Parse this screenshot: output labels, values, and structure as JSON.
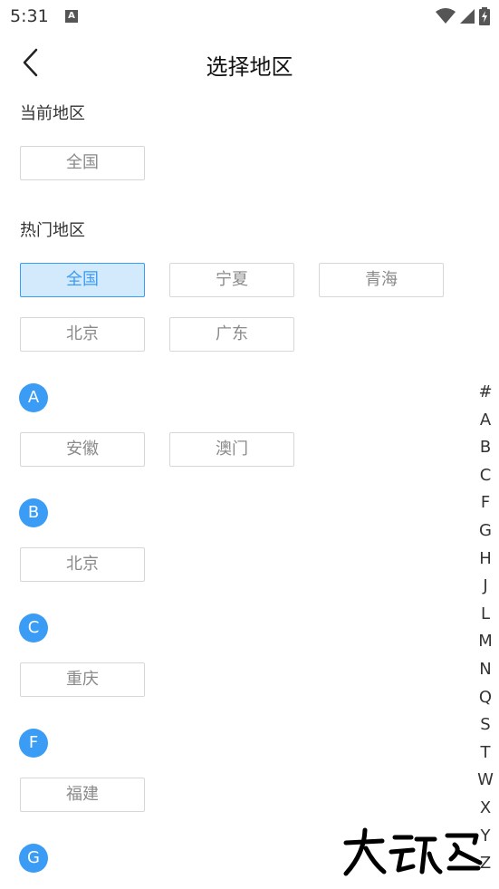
{
  "status": {
    "time": "5:31",
    "notification": "A"
  },
  "header": {
    "title": "选择地区"
  },
  "current": {
    "label": "当前地区",
    "value": "全国"
  },
  "hot": {
    "label": "热门地区",
    "items": [
      "全国",
      "宁夏",
      "青海",
      "北京",
      "广东"
    ],
    "selected_index": 0
  },
  "sections": [
    {
      "letter": "A",
      "items": [
        "安徽",
        "澳门"
      ]
    },
    {
      "letter": "B",
      "items": [
        "北京"
      ]
    },
    {
      "letter": "C",
      "items": [
        "重庆"
      ]
    },
    {
      "letter": "F",
      "items": [
        "福建"
      ]
    },
    {
      "letter": "G",
      "items": []
    }
  ],
  "index_letters": [
    "#",
    "A",
    "B",
    "C",
    "F",
    "G",
    "H",
    "J",
    "L",
    "M",
    "N",
    "Q",
    "S",
    "T",
    "W",
    "X",
    "Y",
    "Z"
  ],
  "colors": {
    "accent": "#3a9cf5",
    "selected_bg": "#d3e9fc",
    "chip_border": "#d7d7d7",
    "chip_text": "#8a8a8a"
  },
  "icons": {
    "back": "chevron-left-icon",
    "wifi": "wifi-icon",
    "signal": "cell-signal-icon",
    "battery": "battery-charging-icon"
  }
}
